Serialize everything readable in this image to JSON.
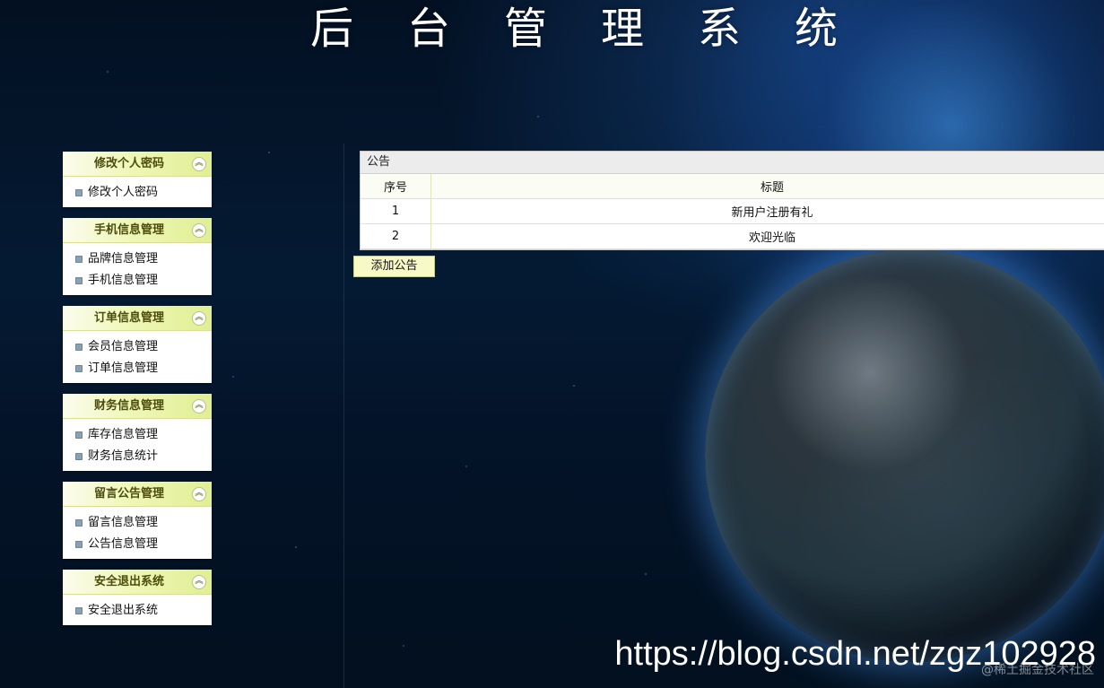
{
  "header": {
    "title": "后台管理系统"
  },
  "sidebar": {
    "groups": [
      {
        "title": "修改个人密码",
        "items": [
          "修改个人密码"
        ]
      },
      {
        "title": "手机信息管理",
        "items": [
          "品牌信息管理",
          "手机信息管理"
        ]
      },
      {
        "title": "订单信息管理",
        "items": [
          "会员信息管理",
          "订单信息管理"
        ]
      },
      {
        "title": "财务信息管理",
        "items": [
          "库存信息管理",
          "财务信息统计"
        ]
      },
      {
        "title": "留言公告管理",
        "items": [
          "留言信息管理",
          "公告信息管理"
        ]
      },
      {
        "title": "安全退出系统",
        "items": [
          "安全退出系统"
        ]
      }
    ]
  },
  "notice": {
    "panel_title": "公告",
    "columns": [
      "序号",
      "标题"
    ],
    "rows": [
      {
        "no": "1",
        "title": "新用户注册有礼"
      },
      {
        "no": "2",
        "title": "欢迎光临"
      }
    ],
    "add_button": "添加公告"
  },
  "watermark": {
    "url": "https://blog.csdn.net/zgz102928",
    "sub": "@稀土掘金技术社区"
  },
  "colors": {
    "menu_header": "#e0ef93",
    "button_bg": "#f7f9c6",
    "background": "#031022"
  }
}
